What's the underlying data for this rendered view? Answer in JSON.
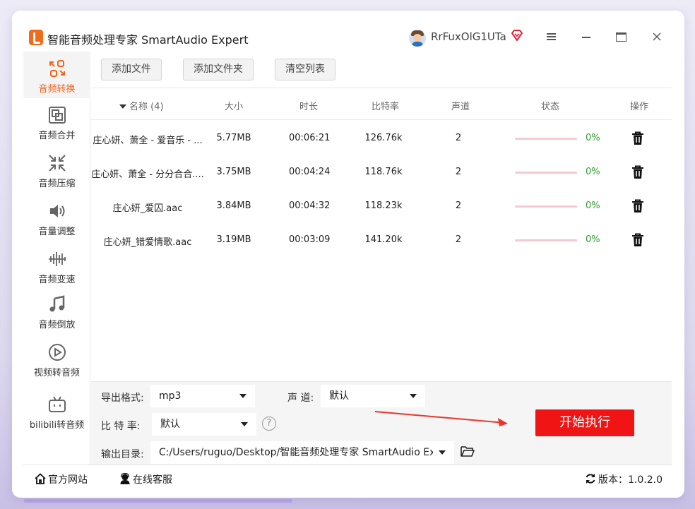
{
  "window": {
    "title": "智能音频处理专家 SmartAudio Expert",
    "username": "RrFuxOlG1UTa"
  },
  "sidebar": {
    "items": [
      {
        "label": "音频转换",
        "icon": "audio-convert-icon",
        "active": true
      },
      {
        "label": "音频合并",
        "icon": "audio-merge-icon",
        "active": false
      },
      {
        "label": "音频压缩",
        "icon": "audio-compress-icon",
        "active": false
      },
      {
        "label": "音量调整",
        "icon": "volume-icon",
        "active": false
      },
      {
        "label": "音频变速",
        "icon": "speed-icon",
        "active": false
      },
      {
        "label": "音频倒放",
        "icon": "music-note-icon",
        "active": false
      },
      {
        "label": "视频转音频",
        "icon": "video-play-icon",
        "active": false
      },
      {
        "label": "bilibili转音频",
        "icon": "bilibili-icon",
        "active": false
      }
    ]
  },
  "toolbar": {
    "add_file": "添加文件",
    "add_folder": "添加文件夹",
    "clear_list": "清空列表"
  },
  "table": {
    "headers": {
      "name": "名称 (4)",
      "size": "大小",
      "duration": "时长",
      "bitrate": "比特率",
      "channels": "声道",
      "status": "状态",
      "actions": "操作"
    },
    "rows": [
      {
        "name": "庄心妍、萧全 - 爱音乐 - ...",
        "size": "5.77MB",
        "duration": "00:06:21",
        "bitrate": "126.76k",
        "channels": "2",
        "progress": 0,
        "percent": "0%"
      },
      {
        "name": "庄心妍、萧全 - 分分合合....",
        "size": "3.75MB",
        "duration": "00:04:24",
        "bitrate": "118.76k",
        "channels": "2",
        "progress": 0,
        "percent": "0%"
      },
      {
        "name": "庄心妍_爱囚.aac",
        "size": "3.84MB",
        "duration": "00:04:32",
        "bitrate": "118.23k",
        "channels": "2",
        "progress": 0,
        "percent": "0%"
      },
      {
        "name": "庄心妍_错爱情歌.aac",
        "size": "3.19MB",
        "duration": "00:03:09",
        "bitrate": "141.20k",
        "channels": "2",
        "progress": 0,
        "percent": "0%"
      }
    ]
  },
  "settings": {
    "format_label": "导出格式:",
    "format_value": "mp3",
    "channel_label": "声 道:",
    "channel_value": "默认",
    "bitrate_label": "比 特 率:",
    "bitrate_value": "默认",
    "help": "?",
    "output_label": "输出目录:",
    "output_value": "C:/Users/ruguo/Desktop/智能音频处理专家 SmartAudio Expert",
    "start_button": "开始执行"
  },
  "footer": {
    "website": "官方网站",
    "support": "在线客服",
    "version": "版本：1.0.2.0"
  },
  "colors": {
    "accent": "#f0641e",
    "start_button": "#f01414",
    "progress_track": "#f6c9d3",
    "percent_text": "#2e9e2e"
  }
}
